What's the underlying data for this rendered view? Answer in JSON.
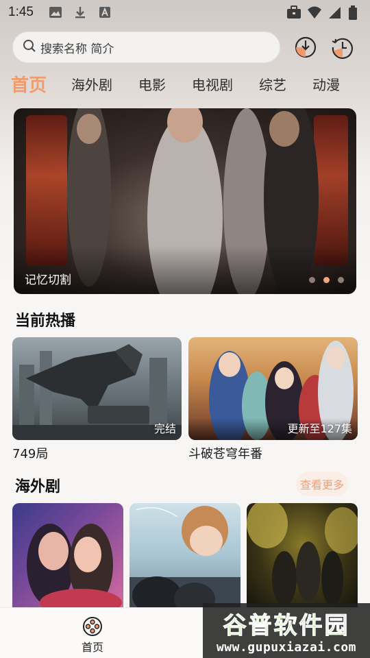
{
  "status": {
    "time": "1:45"
  },
  "search": {
    "placeholder": "搜索名称 简介"
  },
  "tabs": [
    {
      "label": "首页",
      "active": true
    },
    {
      "label": "海外剧"
    },
    {
      "label": "电影"
    },
    {
      "label": "电视剧"
    },
    {
      "label": "综艺"
    },
    {
      "label": "动漫"
    }
  ],
  "banner": {
    "caption": "记忆切割",
    "slide_count": 3,
    "active_slide": 2
  },
  "hot": {
    "title": "当前热播",
    "items": [
      {
        "title": "749局",
        "badge": "完结"
      },
      {
        "title": "斗破苍穹年番",
        "badge": "更新至127集"
      }
    ]
  },
  "overseas": {
    "title": "海外剧",
    "more_label": "查看更多"
  },
  "bottom_nav": {
    "home_label": "首页"
  },
  "watermark": {
    "main": "谷普软件园",
    "sub": "www.gupuxiazai.com"
  },
  "colors": {
    "accent": "#f29a6a",
    "more_bg": "#fbeee7",
    "watermark_green": "#8fd14f"
  }
}
